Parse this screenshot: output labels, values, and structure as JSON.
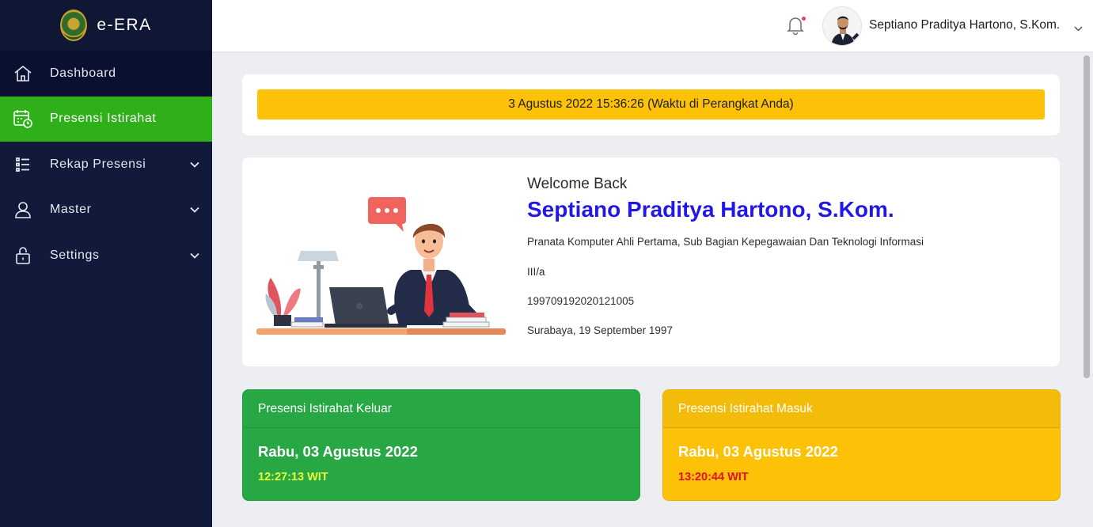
{
  "brand": {
    "name": "e-ERA",
    "logo_icon": "court-emblem-logo"
  },
  "sidebar": {
    "items": [
      {
        "label": "Dashboard",
        "icon": "home-icon",
        "has_submenu": false
      },
      {
        "label": "Presensi Istirahat",
        "icon": "calendar-clock-icon",
        "has_submenu": false,
        "active": true
      },
      {
        "label": "Rekap Presensi",
        "icon": "list-icon",
        "has_submenu": true
      },
      {
        "label": "Master",
        "icon": "user-icon",
        "has_submenu": true
      },
      {
        "label": "Settings",
        "icon": "lock-icon",
        "has_submenu": true
      }
    ]
  },
  "header": {
    "user_name": "Septiano Praditya Hartono, S.Kom.",
    "notification_icon": "bell-icon"
  },
  "datetime": {
    "text": "3 Agustus 2022 15:36:26 (Waktu di Perangkat Anda)"
  },
  "welcome": {
    "greeting": "Welcome Back",
    "name": "Septiano Praditya Hartono, S.Kom.",
    "position": "Pranata Komputer Ahli Pertama, Sub Bagian Kepegawaian Dan Teknologi Informasi",
    "rank": "III/a",
    "nip": "199709192020121005",
    "birth": "Surabaya, 19 September 1997"
  },
  "attendance": {
    "out": {
      "title": "Presensi Istirahat Keluar",
      "date": "Rabu, 03 Agustus 2022",
      "time": "12:27:13 WIT"
    },
    "in": {
      "title": "Presensi Istirahat Masuk",
      "date": "Rabu, 03 Agustus 2022",
      "time": "13:20:44 WIT"
    }
  },
  "colors": {
    "sidebar_bg": "#111a3a",
    "active_nav": "#2fb01b",
    "accent_blue": "#2218e6",
    "warning_yellow": "#fdc107",
    "success_green": "#28a745",
    "time_out_color": "#e7ff3a",
    "time_in_color": "#e0102b"
  }
}
